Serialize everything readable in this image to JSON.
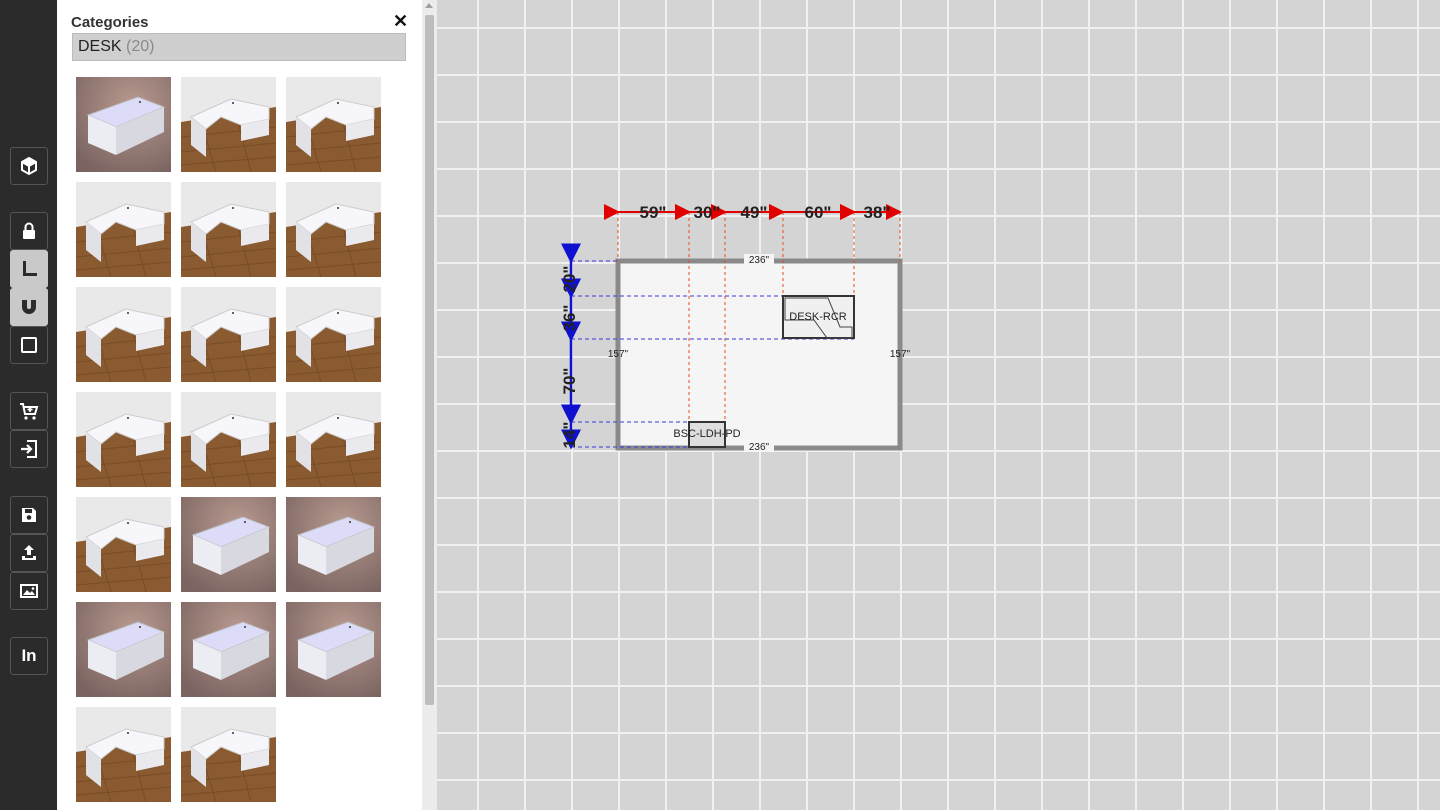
{
  "toolbar": {
    "buttons": [
      {
        "name": "3d-view-icon"
      },
      {
        "name": "lock-icon"
      },
      {
        "name": "dimension-tool-icon"
      },
      {
        "name": "magnet-icon"
      },
      {
        "name": "rectangle-icon"
      },
      {
        "name": "cart-icon"
      },
      {
        "name": "import-icon"
      },
      {
        "name": "save-icon"
      },
      {
        "name": "upload-icon"
      },
      {
        "name": "image-icon"
      },
      {
        "name": "linkedin-label",
        "label": "In"
      }
    ]
  },
  "panel": {
    "title": "Categories",
    "close": "✕",
    "category": "DESK",
    "count": "(20)",
    "thumbnail_count": 20
  },
  "plan": {
    "room_width_top": "236\"",
    "room_width_bottom": "236\"",
    "room_depth_left": "157\"",
    "room_depth_right": "157\"",
    "horizontal_dims": [
      "59\"",
      "30\"",
      "49\"",
      "60\"",
      "38\""
    ],
    "vertical_dims": [
      "20\"",
      "36\"",
      "70\"",
      "14\""
    ],
    "items": [
      {
        "label": "DESK-RCR"
      },
      {
        "label": "BSC-LDH-PD"
      }
    ]
  }
}
